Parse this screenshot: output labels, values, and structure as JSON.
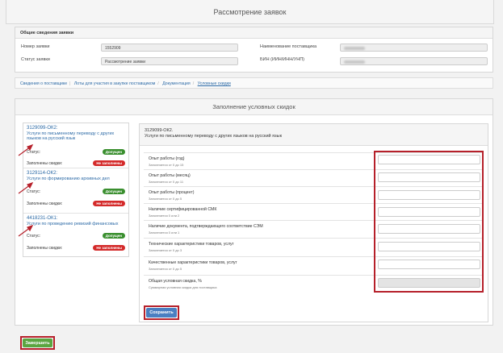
{
  "page": {
    "title": "Рассмотрение заявок"
  },
  "general": {
    "heading": "Общие сведения заявки",
    "labels": {
      "number": "Номер заявки",
      "status": "Статус заявки",
      "supplier": "Наименование поставщика",
      "bin": "БИН (ИИН/ИНН/УНП)"
    },
    "values": {
      "number": "1552909",
      "status": "Рассмотрение заявки"
    }
  },
  "breadcrumbs": [
    "Сведения о поставщике",
    "Лоты для участия в закупке поставщиком",
    "Документация",
    "Условные скидки"
  ],
  "conditional": {
    "heading": "Заполнение условных скидок"
  },
  "lots": [
    {
      "code": "3129099-ОК2:",
      "desc": "Услуги по письменному переводу с других языков на русский язык",
      "status_label": "Статус:",
      "status": "Допущен",
      "discount_label": "Заполнены скидки:",
      "discount": "Не заполнены"
    },
    {
      "code": "3129114-ОК2:",
      "desc": "Услуги по формированию архивных дел",
      "status_label": "Статус:",
      "status": "Допущен",
      "discount_label": "Заполнены скидки:",
      "discount": "Не заполнены"
    },
    {
      "code": "4418231-ОК1:",
      "desc": "Услуги по проведению ревизий финансовых",
      "status_label": "Статус:",
      "status": "Допущен",
      "discount_label": "Заполнены скидки:",
      "discount": "Не заполнены"
    }
  ],
  "selected_lot": {
    "code": "3129099-ОК2.",
    "desc": "Услуги по письменному переводу с других языков на русский язык"
  },
  "criteria": [
    {
      "name": "Опыт работы (год)",
      "hint": "Заполняется от 0 до 15"
    },
    {
      "name": "Опыт работы (месяц)",
      "hint": "Заполняется от 0 до 11"
    },
    {
      "name": "Опыт работы (процент)",
      "hint": "Заполняется от 0 до 5"
    },
    {
      "name": "Наличие сертифицированной СМК",
      "hint": "Заполняется 0 или 2"
    },
    {
      "name": "Наличие документа, подтверждающего соответствие СЭМ",
      "hint": "Заполняется 0 или 1"
    },
    {
      "name": "Технические характеристики товаров, услуг",
      "hint": "Заполняется от 0 до 3"
    },
    {
      "name": "Качественные характеристики товаров, услуг",
      "hint": "Заполняется от 0 до 5"
    },
    {
      "name": "Общая условная скидка, %",
      "hint": "Суммарная условная скидка для поставщика"
    }
  ],
  "buttons": {
    "save": "Сохранить",
    "finish": "Завершить"
  },
  "colors": {
    "highlight": "#b6202a",
    "admitted": "#3a8f2f",
    "not_filled": "#d42a2a",
    "link": "#2c6aa6"
  }
}
